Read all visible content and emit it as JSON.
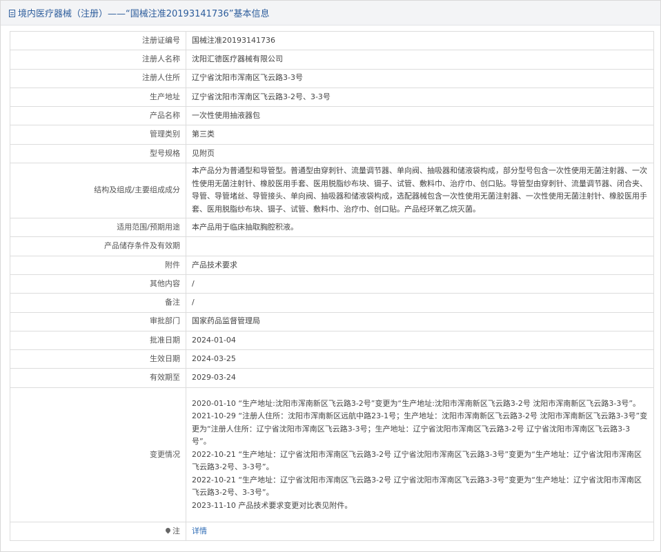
{
  "header": {
    "title": "境内医疗器械（注册）——“国械注准20193141736”基本信息"
  },
  "rows": [
    {
      "label": "注册证编号",
      "value": "国械注准20193141736"
    },
    {
      "label": "注册人名称",
      "value": "沈阳汇德医疗器械有限公司"
    },
    {
      "label": "注册人住所",
      "value": "辽宁省沈阳市浑南区飞云路3-3号"
    },
    {
      "label": "生产地址",
      "value": "辽宁省沈阳市浑南区飞云路3-2号、3-3号"
    },
    {
      "label": "产品名称",
      "value": "一次性使用抽液器包"
    },
    {
      "label": "管理类别",
      "value": "第三类"
    },
    {
      "label": "型号规格",
      "value": "见附页"
    },
    {
      "label": "结构及组成/主要组成成分",
      "value": "本产品分为普通型和导管型。普通型由穿刺针、流量调节器、单向阀、抽吸器和储液袋构成，部分型号包含一次性使用无菌注射器、一次性使用无菌注射针、橡胶医用手套、医用脱脂纱布块、镊子、试管、敷料巾、治疗巾、创口贴。导管型由穿刺针、流量调节器、闭合夹、导管、导管堵丝、导管接头、单向阀、抽吸器和储液袋构成，选配器械包含一次性使用无菌注射器、一次性使用无菌注射针、橡胶医用手套、医用脱脂纱布块、镊子、试管、敷料巾、治疗巾、创口贴。产品经环氧乙烷灭菌。"
    },
    {
      "label": "适用范围/预期用途",
      "value": "本产品用于临床抽取胸腔积液。"
    },
    {
      "label": "产品储存条件及有效期",
      "value": ""
    },
    {
      "label": "附件",
      "value": "产品技术要求"
    },
    {
      "label": "其他内容",
      "value": "/"
    },
    {
      "label": "备注",
      "value": "/"
    },
    {
      "label": "审批部门",
      "value": "国家药品监督管理局"
    },
    {
      "label": "批准日期",
      "value": "2024-01-04"
    },
    {
      "label": "生效日期",
      "value": "2024-03-25"
    },
    {
      "label": "有效期至",
      "value": "2029-03-24"
    }
  ],
  "changes": {
    "label": "变更情况",
    "entries": [
      "2020-01-10 “生产地址:沈阳市浑南新区飞云路3-2号”变更为“生产地址:沈阳市浑南新区飞云路3-2号 沈阳市浑南新区飞云路3-3号”。",
      "2021-10-29 “注册人住所：沈阳市浑南新区远航中路23-1号；生产地址：沈阳市浑南新区飞云路3-2号 沈阳市浑南新区飞云路3-3号”变更为“注册人住所：辽宁省沈阳市浑南区飞云路3-3号；生产地址：辽宁省沈阳市浑南区飞云路3-2号 辽宁省沈阳市浑南区飞云路3-3号”。",
      "2022-10-21 “生产地址：辽宁省沈阳市浑南区飞云路3-2号 辽宁省沈阳市浑南区飞云路3-3号”变更为“生产地址：辽宁省沈阳市浑南区飞云路3-2号、3-3号”。",
      "2022-10-21 “生产地址：辽宁省沈阳市浑南区飞云路3-2号 辽宁省沈阳市浑南区飞云路3-3号”变更为“生产地址：辽宁省沈阳市浑南区飞云路3-2号、3-3号”。",
      "2023-11-10 产品技术要求变更对比表见附件。"
    ]
  },
  "note": {
    "label": "注",
    "icon": "pin-icon",
    "link_text": "详情"
  }
}
